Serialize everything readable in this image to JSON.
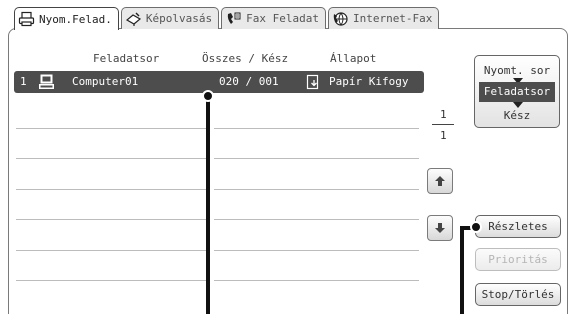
{
  "tabs": [
    {
      "label": "Nyom.Felad.",
      "icon": "printer-icon",
      "active": true
    },
    {
      "label": "Képolvasás",
      "icon": "scan-icon",
      "active": false
    },
    {
      "label": "Fax Feladat",
      "icon": "fax-icon",
      "active": false
    },
    {
      "label": "Internet-Fax",
      "icon": "internet-fax-icon",
      "active": false
    }
  ],
  "columns": {
    "job_queue": "Feladatsor",
    "set_done": "Összes / Kész",
    "status": "Állapot"
  },
  "jobs": [
    {
      "index": "1",
      "name": "Computer01",
      "sets": "020 / 001",
      "status": "Papír Kifogy",
      "selected": true
    }
  ],
  "pager": {
    "current": "1",
    "total": "1"
  },
  "mode_selector": {
    "top": "Nyomt. sor",
    "middle": "Feladatsor",
    "bottom": "Kész"
  },
  "buttons": {
    "detail": "Részletes",
    "priority": "Prioritás",
    "stop_delete": "Stop/Törlés"
  },
  "colors": {
    "selected_row": "#4d4d4d",
    "callout": "#111111"
  }
}
